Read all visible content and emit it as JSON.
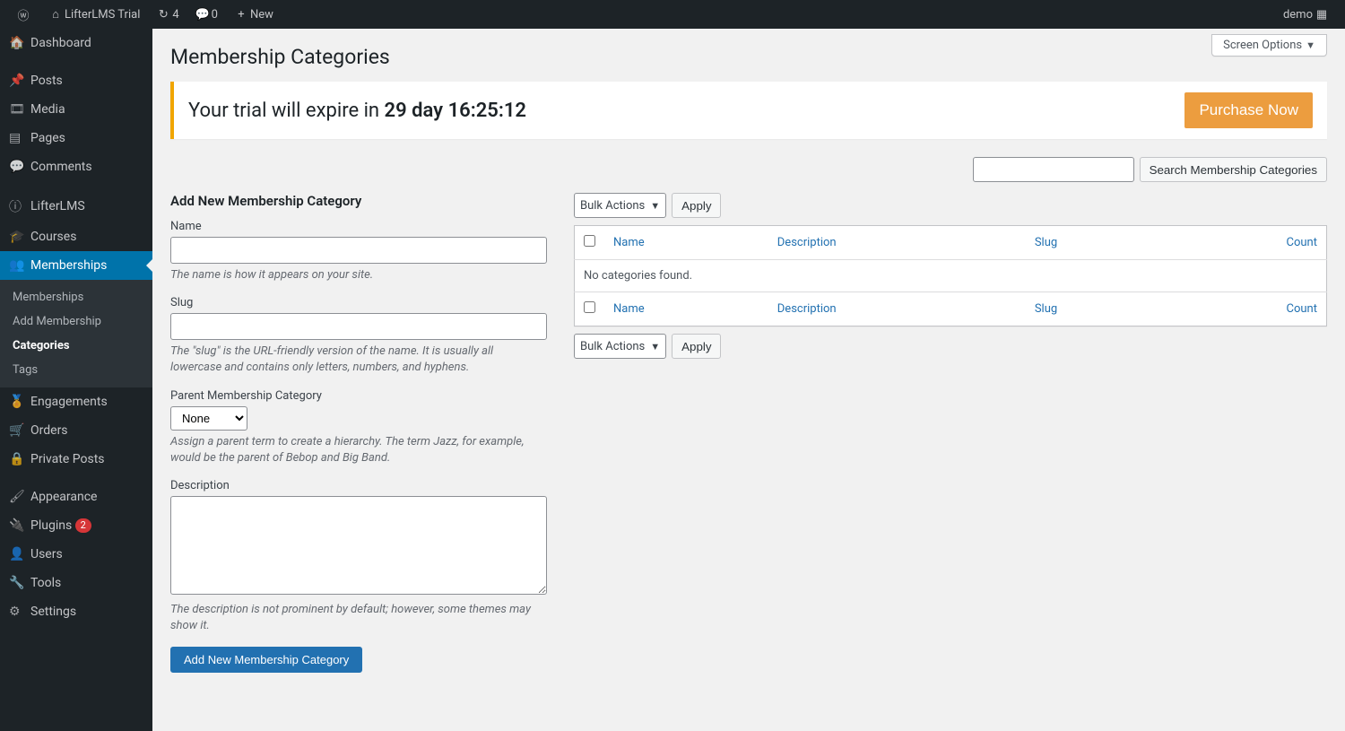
{
  "adminbar": {
    "site_name": "LifterLMS Trial",
    "updates": "4",
    "comments": "0",
    "new_label": "New",
    "user": "demo"
  },
  "sidebar": {
    "items": [
      {
        "label": "Dashboard"
      },
      {
        "label": "Posts"
      },
      {
        "label": "Media"
      },
      {
        "label": "Pages"
      },
      {
        "label": "Comments"
      },
      {
        "label": "LifterLMS"
      },
      {
        "label": "Courses"
      },
      {
        "label": "Memberships"
      },
      {
        "label": "Engagements"
      },
      {
        "label": "Orders"
      },
      {
        "label": "Private Posts"
      },
      {
        "label": "Appearance"
      },
      {
        "label": "Plugins",
        "badge": "2"
      },
      {
        "label": "Users"
      },
      {
        "label": "Tools"
      },
      {
        "label": "Settings"
      }
    ],
    "submenu": [
      {
        "label": "Memberships"
      },
      {
        "label": "Add Membership"
      },
      {
        "label": "Categories"
      },
      {
        "label": "Tags"
      }
    ]
  },
  "screen_options": "Screen Options",
  "page_title": "Membership Categories",
  "trial": {
    "prefix": "Your trial will expire in ",
    "time": "29 day 16:25:12",
    "purchase": "Purchase Now"
  },
  "search": {
    "button": "Search Membership Categories"
  },
  "form": {
    "title": "Add New Membership Category",
    "name_label": "Name",
    "name_help": "The name is how it appears on your site.",
    "slug_label": "Slug",
    "slug_help": "The \"slug\" is the URL-friendly version of the name. It is usually all lowercase and contains only letters, numbers, and hyphens.",
    "parent_label": "Parent Membership Category",
    "parent_option": "None",
    "parent_help": "Assign a parent term to create a hierarchy. The term Jazz, for example, would be the parent of Bebop and Big Band.",
    "desc_label": "Description",
    "desc_help": "The description is not prominent by default; however, some themes may show it.",
    "submit": "Add New Membership Category"
  },
  "table": {
    "bulk_label": "Bulk Actions",
    "apply": "Apply",
    "cols": {
      "name": "Name",
      "description": "Description",
      "slug": "Slug",
      "count": "Count"
    },
    "empty": "No categories found."
  }
}
